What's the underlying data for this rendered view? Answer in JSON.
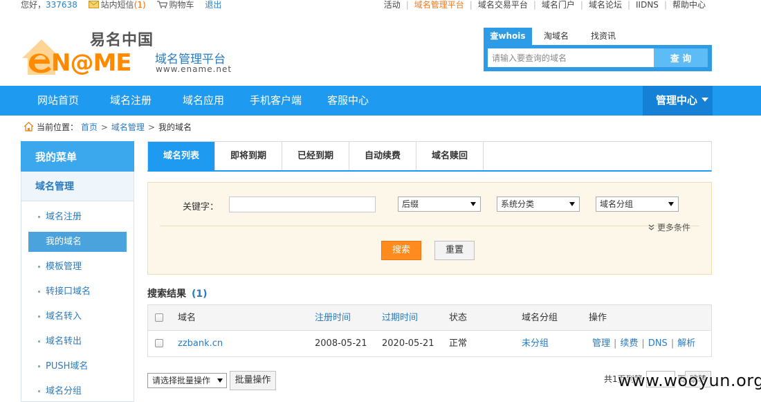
{
  "topbar": {
    "greeting": "您好，",
    "user_id": "337638",
    "messages_label": "站内短信",
    "messages_count": "(1)",
    "cart_label": "购物车",
    "logout_label": "退出",
    "links": [
      "活动",
      "域名管理平台",
      "域名交易平台",
      "域名门户",
      "域名论坛",
      "IIDNS",
      "帮助中心"
    ],
    "active_link": "域名管理平台"
  },
  "brand": {
    "cn_name": "易名中国",
    "en_name": "N@ME",
    "platform_title": "域名管理平台",
    "url": "www.ename.net"
  },
  "search": {
    "tabs": [
      "查whois",
      "淘域名",
      "找资讯"
    ],
    "placeholder": "请输入要查询的域名",
    "button": "查 询"
  },
  "nav": {
    "items": [
      "网站首页",
      "域名注册",
      "域名应用",
      "手机客户端",
      "客服中心"
    ],
    "manage": "管理中心"
  },
  "breadcrumb": {
    "prefix": "当前位置：",
    "home": "首页",
    "section": "域名管理",
    "current": "我的域名"
  },
  "sidebar": {
    "title": "我的菜单",
    "group": "域名管理",
    "items": [
      "域名注册",
      "我的域名",
      "模板管理",
      "转接口域名",
      "域名转入",
      "域名转出",
      "PUSH域名",
      "域名分组"
    ],
    "active": "我的域名"
  },
  "tabs": {
    "items": [
      "域名列表",
      "即将到期",
      "已经到期",
      "自动续费",
      "域名赎回"
    ],
    "active": "域名列表"
  },
  "filter": {
    "keyword_label": "关键字：",
    "keyword_value": "",
    "suffix_select": "后缀",
    "category_select": "系统分类",
    "group_select": "域名分组",
    "more_label": "更多条件",
    "search_button": "搜索",
    "reset_button": "重置"
  },
  "results": {
    "title": "搜索结果",
    "count": "(1)",
    "columns": [
      "域名",
      "注册时间",
      "过期时间",
      "状态",
      "域名分组",
      "操作"
    ],
    "rows": [
      {
        "domain": "zzbank.cn",
        "reg_date": "2008-05-21",
        "exp_date": "2020-05-21",
        "status": "正常",
        "group": "未分组",
        "ops": [
          "管理",
          "续费",
          "DNS",
          "解析"
        ]
      }
    ]
  },
  "bottom": {
    "batch_select": "请选择批量操作",
    "batch_button": "批量操作",
    "pager_text": "共1页到第",
    "pager_unit": "页",
    "pager_button": "跳转",
    "watermark": "www.wooyun.org"
  },
  "colors": {
    "nav_blue": "#1e9af0",
    "manage_blue": "#1481d6",
    "link_blue": "#2a7bc0",
    "brand_orange": "#ff8a00",
    "search_button_orange": "#ff8a1e",
    "filter_background": "#fdf7ea"
  }
}
